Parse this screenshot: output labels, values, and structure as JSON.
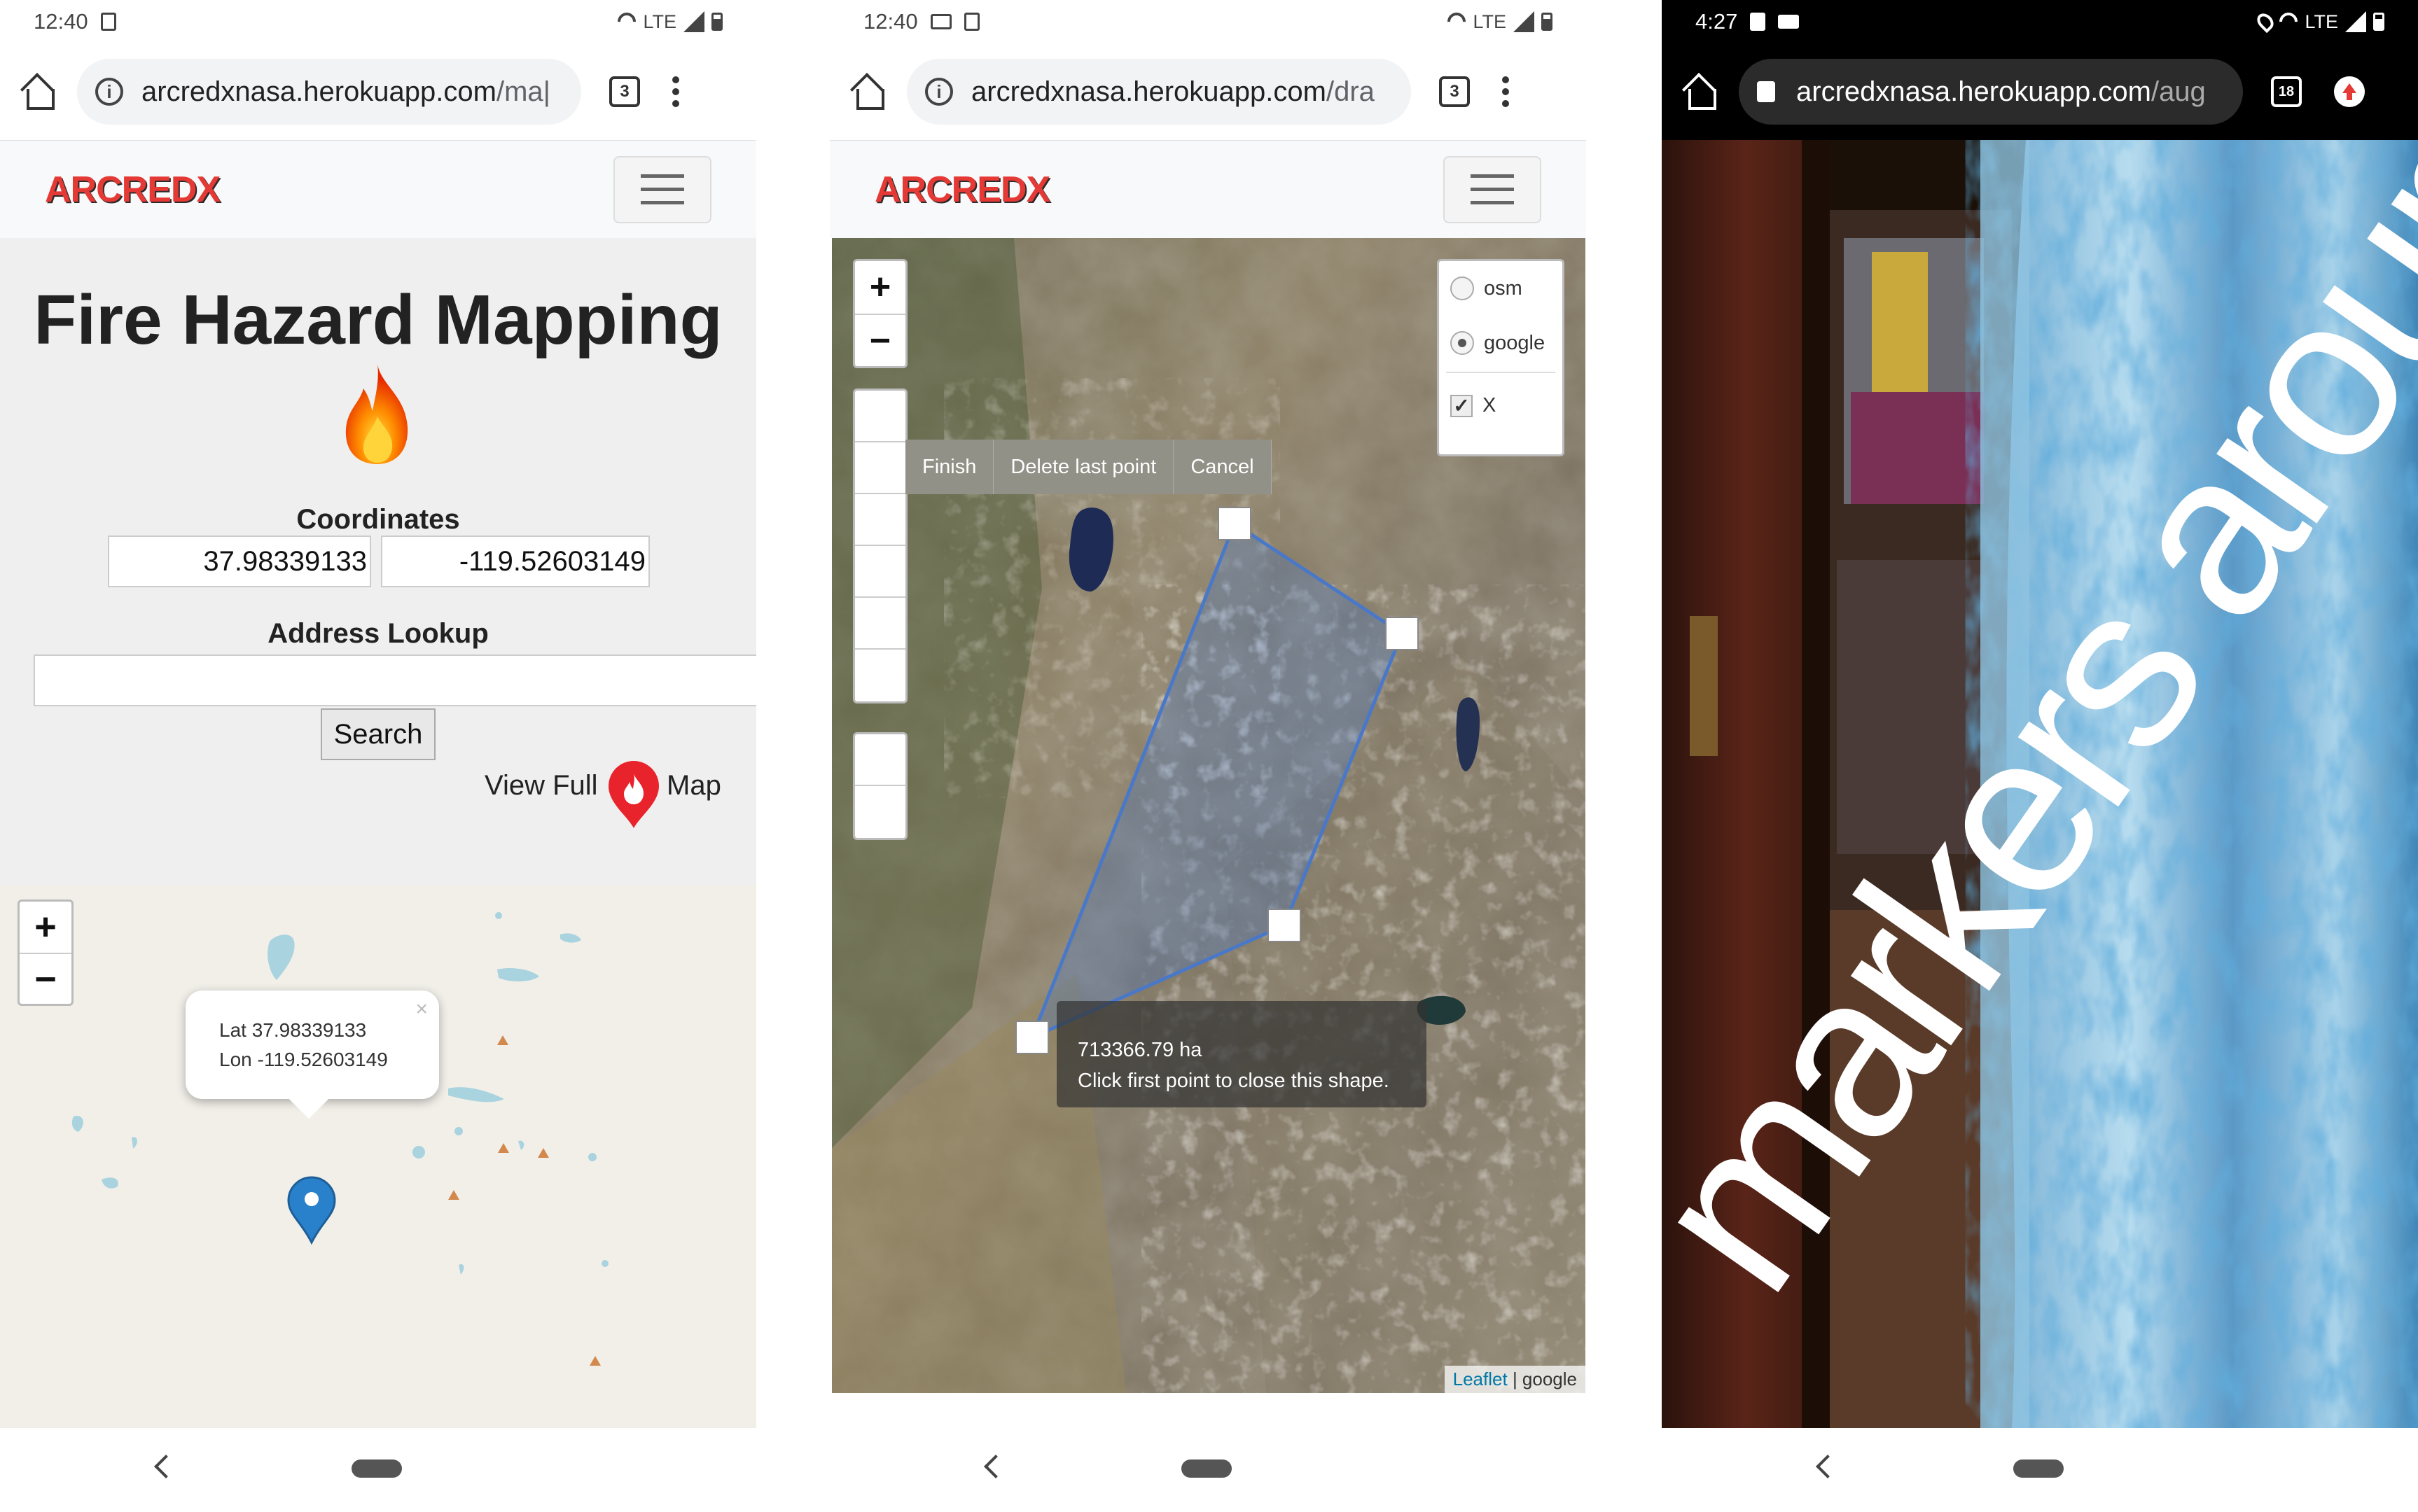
{
  "phone1": {
    "status": {
      "time": "12:40",
      "network": "LTE"
    },
    "browser": {
      "url_host": "arcredxnasa.herokuapp.com",
      "url_path": "/ma|",
      "tab_count": "3"
    },
    "navbar": {
      "logo": "ARCREDX"
    },
    "page": {
      "title": "Fire Hazard Mapping",
      "coordinates_label": "Coordinates",
      "latitude_value": "37.98339133",
      "longitude_value": "-119.52603149",
      "address_label": "Address Lookup",
      "address_value": "",
      "search_label": "Search",
      "view_full": "View Full",
      "map_word": "Map"
    },
    "map": {
      "zoom_in": "+",
      "zoom_out": "−",
      "popup_lat": "Lat 37.98339133",
      "popup_lon": "Lon -119.52603149",
      "popup_close": "×"
    }
  },
  "phone2": {
    "status": {
      "time": "12:40",
      "network": "LTE"
    },
    "browser": {
      "url_host": "arcredxnasa.herokuapp.com",
      "url_path": "/dra",
      "tab_count": "3"
    },
    "navbar": {
      "logo": "ARCREDX"
    },
    "map": {
      "zoom_in": "+",
      "zoom_out": "−",
      "actions": [
        "Finish",
        "Delete last point",
        "Cancel"
      ],
      "layers": {
        "osm": "osm",
        "google": "google",
        "overlay": "X",
        "selected": "google",
        "overlay_checked": true
      },
      "tooltip_area": "713366.79 ha",
      "tooltip_hint": "Click first point to close this shape.",
      "attribution_link": "Leaflet",
      "attribution_sep": " | ",
      "attribution_source": "google"
    }
  },
  "phone3": {
    "status": {
      "time": "4:27",
      "network": "LTE"
    },
    "browser": {
      "url_host": "arcredxnasa.herokuapp.com",
      "url_path": "/aug",
      "tab_count": "18"
    },
    "camera_overlay_text": "markers around"
  },
  "colors": {
    "brand_red": "#e53935",
    "polygon": "#4a78c8",
    "marker_blue": "#2a81cb"
  }
}
